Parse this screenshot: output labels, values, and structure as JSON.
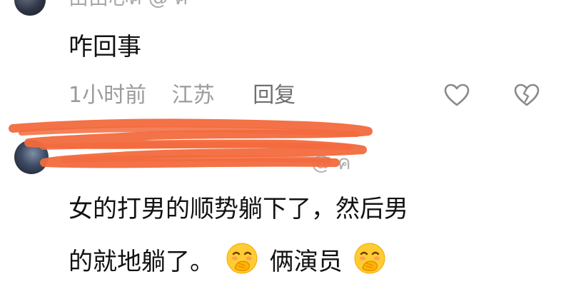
{
  "comment_1": {
    "username": "由由心ค่ @ ค",
    "text": "咋回事",
    "meta": {
      "time": "1小时前",
      "location": "江苏",
      "reply_label": "回复"
    }
  },
  "comment_2": {
    "username_suffix": "@ ค",
    "text_line1": "女的打男的顺势躺下了，然后男",
    "text_line2_part1": "的就地躺了。",
    "text_line2_part2": "俩演员",
    "emoji_name": "face-with-hand-over-mouth"
  },
  "colors": {
    "scribble": "#f26a3d",
    "meta_text": "#9b9b9b",
    "comment_text": "#121212"
  }
}
